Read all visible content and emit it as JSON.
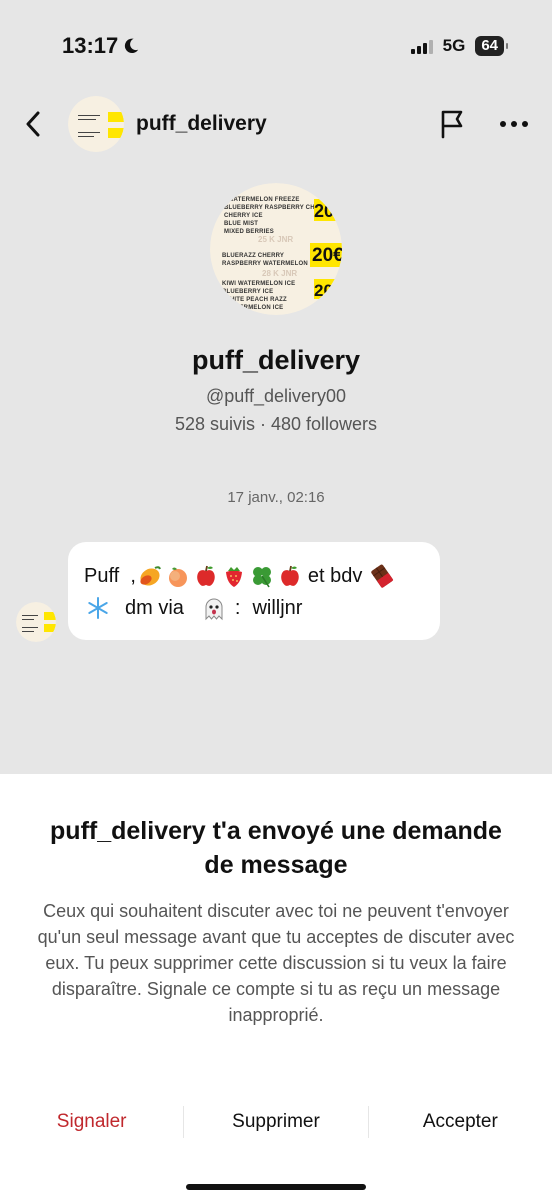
{
  "status_bar": {
    "time": "13:17",
    "network": "5G",
    "battery": "64",
    "signal_bars_active": 3,
    "signal_bars_total": 4
  },
  "header": {
    "username": "puff_delivery",
    "back_icon": "chevron-left-icon",
    "flag_icon": "flag-icon",
    "more_icon": "more-horizontal-icon"
  },
  "profile": {
    "name": "puff_delivery",
    "handle": "@puff_delivery00",
    "stats": "528 suivis · 480 followers",
    "avatar_text": {
      "items_top": [
        "WATERMELON FREEZE",
        "BLUEBERRY RASPBERRY CHERRY",
        "CHERRY ICE",
        "BLUE MIST",
        "MIXED BERRIES"
      ],
      "price_mid": "25 K JNR",
      "items_mid": [
        "BLUERAZZ CHERRY",
        "RASPBERRY WATERMELON"
      ],
      "price_bottom": "28 K JNR",
      "items_bottom": [
        "KIWI WATERMELON ICE",
        "BLUEBERRY ICE",
        "WHITE PEACH RAZZ",
        "WATERMELON ICE"
      ],
      "badge": "20€"
    }
  },
  "conversation": {
    "timestamp": "17 janv., 02:16",
    "message": {
      "line1_start": "Puff  ,",
      "line1_end": "et bdv",
      "line2_mid": "dm via",
      "line2_sep": ":",
      "line2_end": "willjnr"
    }
  },
  "sheet": {
    "title": "puff_delivery t'a envoyé une demande de message",
    "body": "Ceux qui souhaitent discuter avec toi ne peuvent t'envoyer qu'un seul message avant que tu acceptes de discuter avec eux. Tu peux supprimer cette discussion si tu veux la faire disparaître. Signale ce compte si tu as reçu un message inapproprié.",
    "actions": {
      "report": "Signaler",
      "delete": "Supprimer",
      "accept": "Accepter"
    }
  },
  "colors": {
    "background": "#e6e6e6",
    "report": "#c0282d",
    "badge_yellow": "#ffe600"
  }
}
